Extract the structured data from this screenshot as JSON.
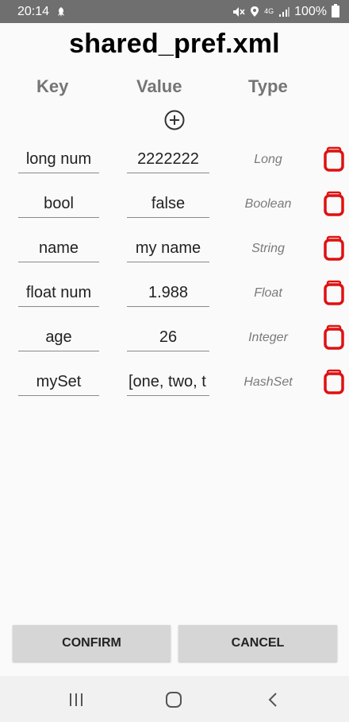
{
  "status_bar": {
    "time": "20:14",
    "network": "4G",
    "battery_percent": "100%",
    "icons": [
      "notification-icon",
      "mute-icon",
      "location-icon",
      "network-4g-icon",
      "signal-icon",
      "battery-icon"
    ]
  },
  "page": {
    "title": "shared_pref.xml"
  },
  "columns": {
    "key": "Key",
    "value": "Value",
    "type": "Type"
  },
  "rows": [
    {
      "key": "long num",
      "value": "2222222",
      "type": "Long"
    },
    {
      "key": "bool",
      "value": "false",
      "type": "Boolean"
    },
    {
      "key": "name",
      "value": "my name",
      "type": "String"
    },
    {
      "key": "float num",
      "value": "1.988",
      "type": "Float"
    },
    {
      "key": "age",
      "value": "26",
      "type": "Integer"
    },
    {
      "key": "mySet",
      "value": "[one, two, t",
      "type": "HashSet"
    }
  ],
  "actions": {
    "confirm": "CONFIRM",
    "cancel": "CANCEL"
  },
  "colors": {
    "delete_accent": "#e01010",
    "status_bar_bg": "#6f6f6f",
    "button_bg": "#d6d6d6",
    "header_text": "#757575"
  },
  "icons": {
    "add": "add-circle-icon",
    "delete": "trash-icon",
    "nav": [
      "recent-apps-icon",
      "home-icon",
      "back-icon"
    ]
  }
}
